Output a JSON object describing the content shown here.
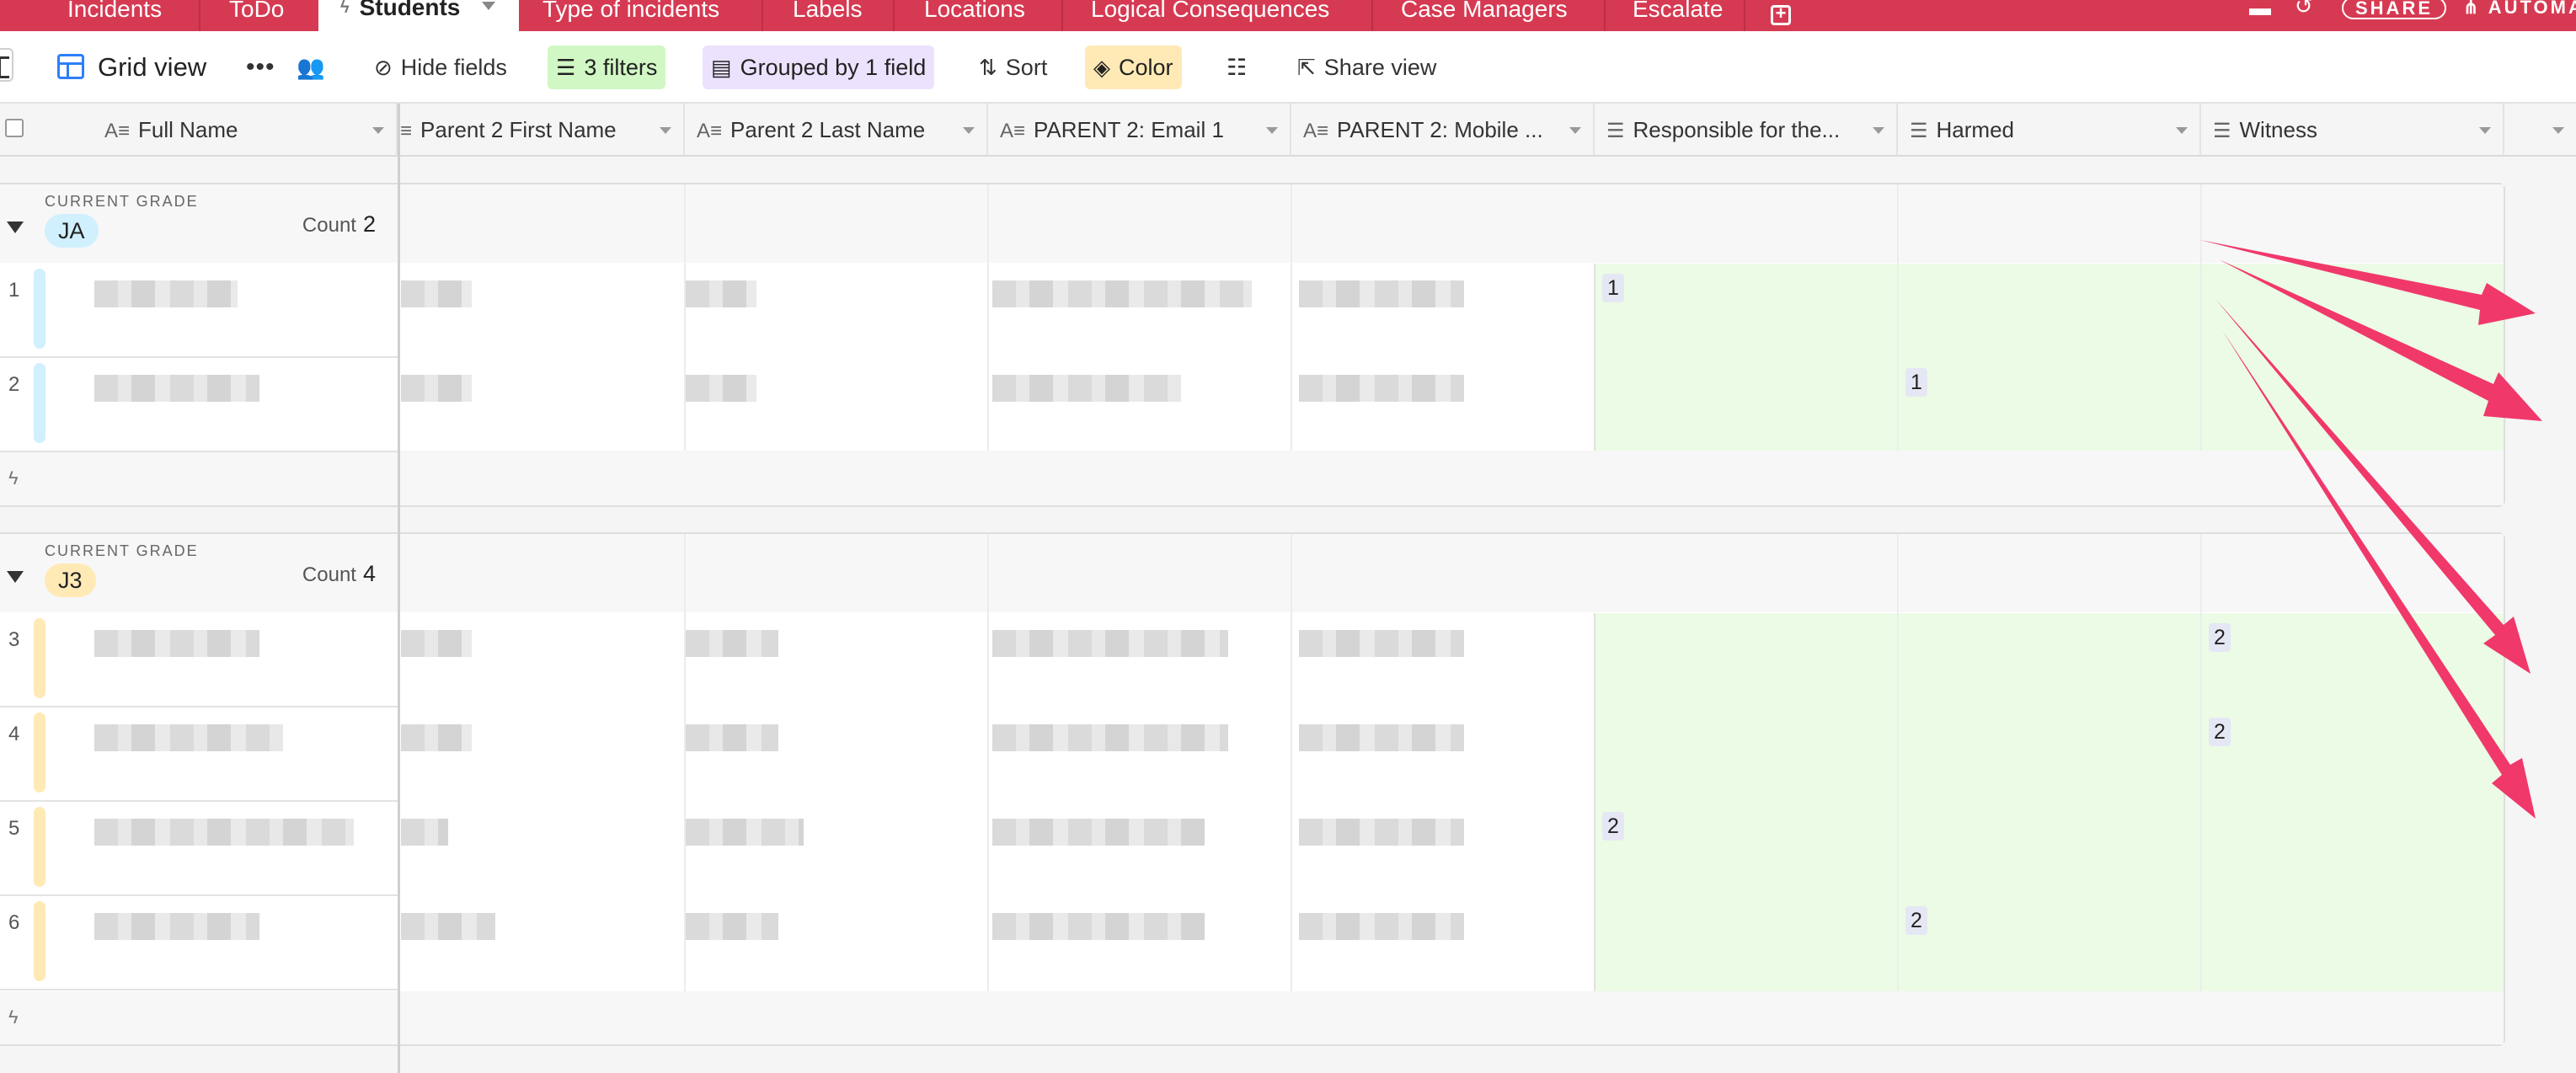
{
  "tabs": [
    {
      "label": "Incidents",
      "active": false
    },
    {
      "label": "ToDo",
      "active": false
    },
    {
      "label": "Students",
      "active": true
    },
    {
      "label": "Type of incidents",
      "active": false
    },
    {
      "label": "Labels",
      "active": false
    },
    {
      "label": "Locations",
      "active": false
    },
    {
      "label": "Logical Consequences",
      "active": false
    },
    {
      "label": "Case Managers",
      "active": false
    },
    {
      "label": "Escalate",
      "active": false
    }
  ],
  "topbar": {
    "share_label": "SHARE",
    "automations_label": "AUTOMATIONS",
    "trash_icon": "trash-icon",
    "history_icon": "history-icon"
  },
  "toolbar": {
    "view_label": "Grid view",
    "hide_fields_label": "Hide fields",
    "filters_label": "3 filters",
    "grouped_label": "Grouped by 1 field",
    "sort_label": "Sort",
    "color_label": "Color",
    "share_view_label": "Share view"
  },
  "columns": [
    {
      "label": "Full Name",
      "icon": "formula-text-icon"
    },
    {
      "label": "Parent 2 First Name",
      "icon": "formula-text-icon"
    },
    {
      "label": "Parent 2 Last Name",
      "icon": "formula-text-icon"
    },
    {
      "label": "PARENT 2: Email 1",
      "icon": "formula-text-icon"
    },
    {
      "label": "PARENT 2: Mobile ...",
      "icon": "formula-text-icon"
    },
    {
      "label": "Responsible for the...",
      "icon": "rollup-icon"
    },
    {
      "label": "Harmed",
      "icon": "rollup-icon"
    },
    {
      "label": "Witness",
      "icon": "rollup-icon"
    }
  ],
  "groups": [
    {
      "field_label": "CURRENT GRADE",
      "value": "JA",
      "chip_color": "#d0f0fd",
      "count_label": "Count",
      "count": "2",
      "rows": [
        {
          "num": "1",
          "responsible": "1",
          "harmed": "",
          "witness": ""
        },
        {
          "num": "2",
          "responsible": "",
          "harmed": "1",
          "witness": ""
        }
      ]
    },
    {
      "field_label": "CURRENT GRADE",
      "value": "J3",
      "chip_color": "#ffeab6",
      "count_label": "Count",
      "count": "4",
      "rows": [
        {
          "num": "3",
          "responsible": "",
          "harmed": "",
          "witness": "2"
        },
        {
          "num": "4",
          "responsible": "",
          "harmed": "",
          "witness": "2"
        },
        {
          "num": "5",
          "responsible": "2",
          "harmed": "",
          "witness": ""
        },
        {
          "num": "6",
          "responsible": "",
          "harmed": "2",
          "witness": ""
        }
      ]
    }
  ],
  "colors": {
    "brand": "#d63a52",
    "annotation_arrow": "#f0386b",
    "group_ja": "#d0f0fd",
    "group_j3": "#ffeab6",
    "highlight_column": "#ecfbe5"
  }
}
